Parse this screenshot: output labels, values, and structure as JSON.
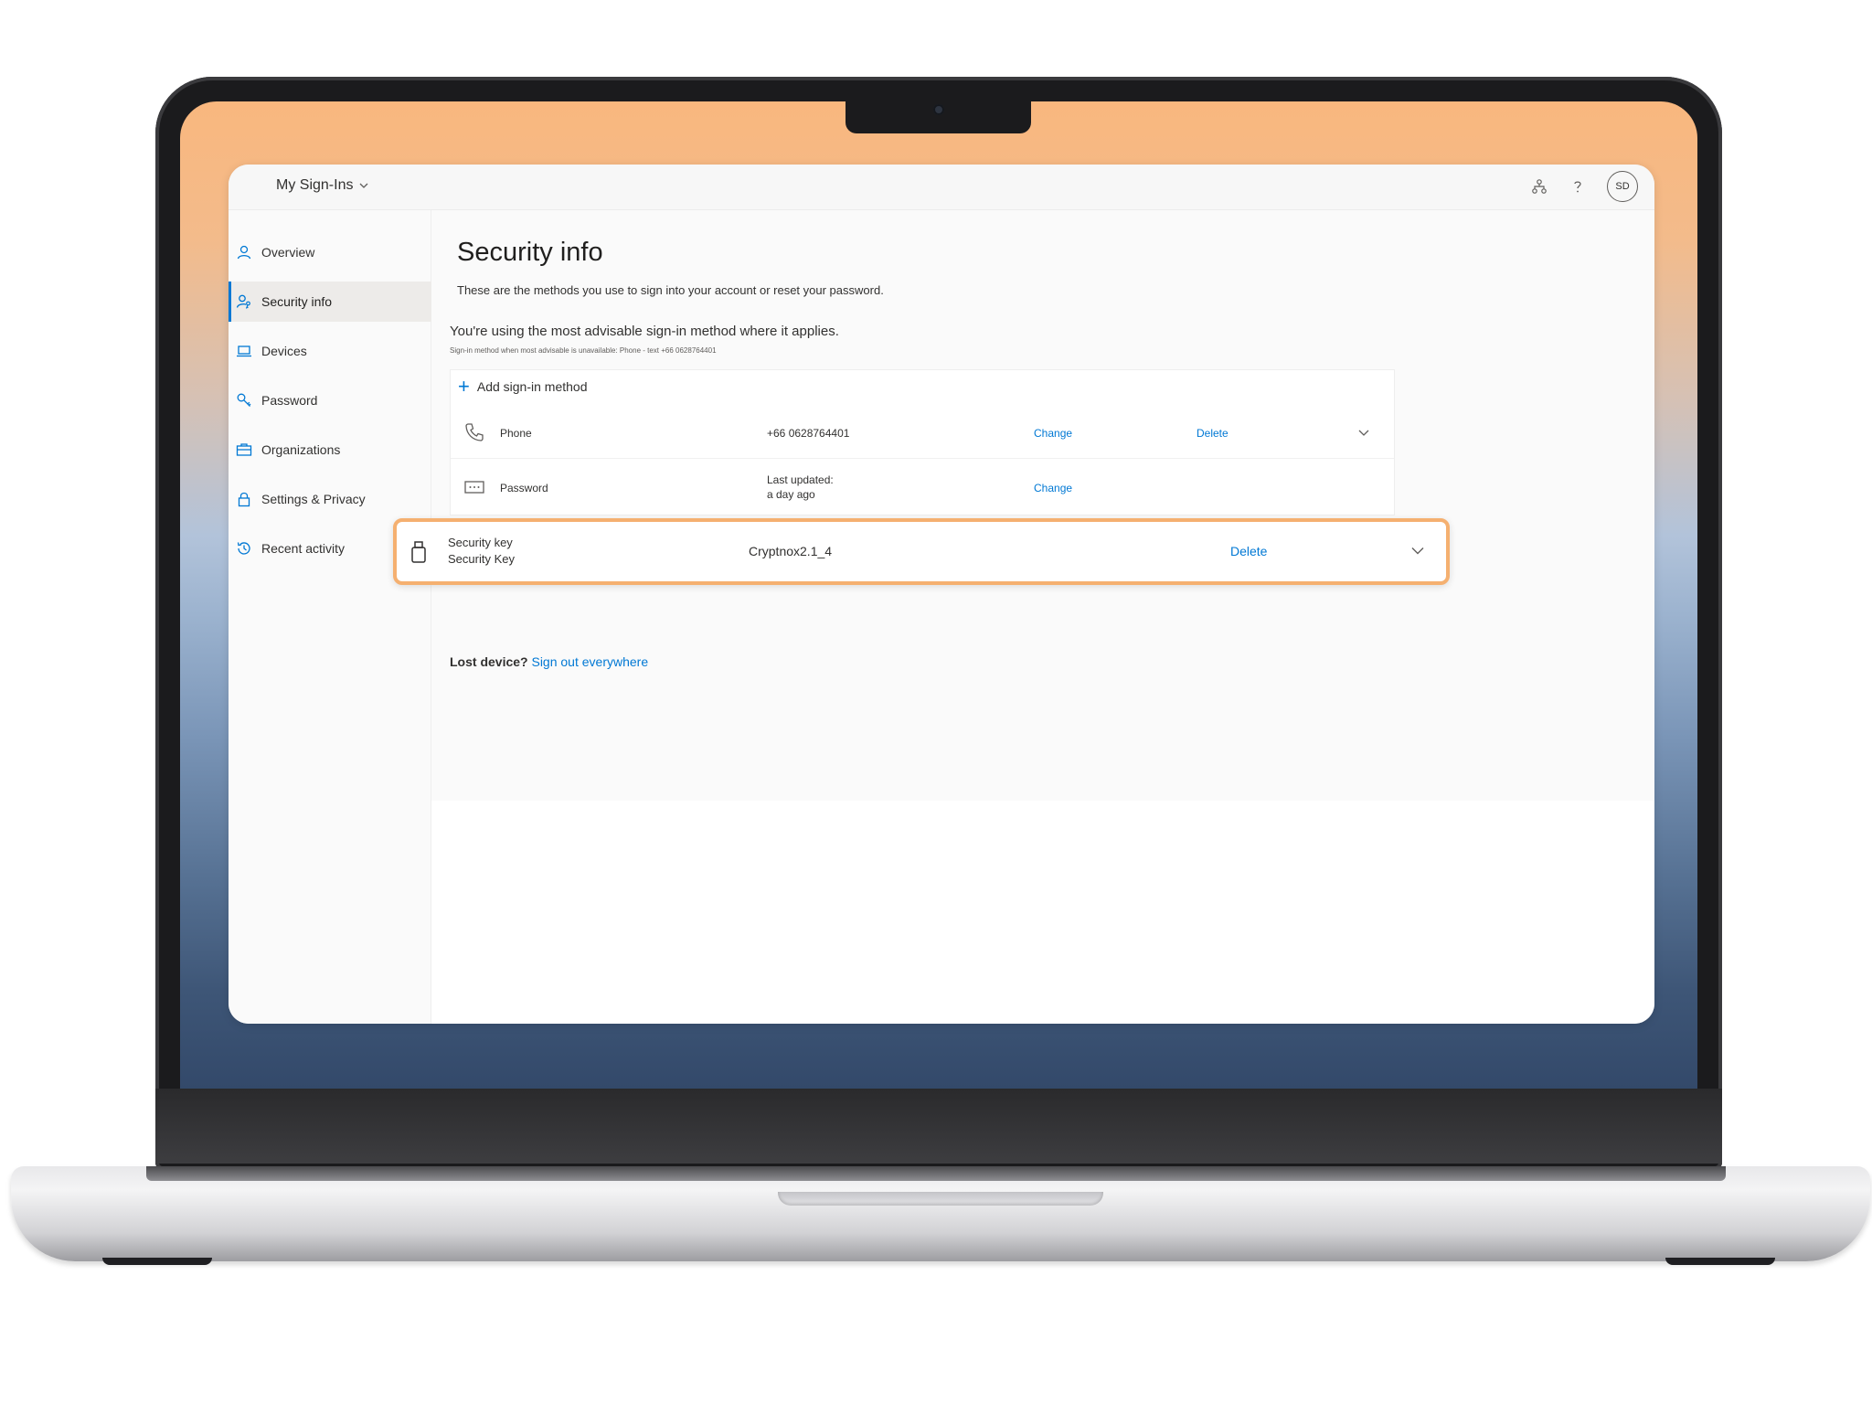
{
  "app": {
    "title": "My Sign-Ins",
    "avatar_initials": "SD",
    "accent_color": "#0078d4",
    "highlight_color": "#f5b070"
  },
  "sidebar": {
    "items": [
      {
        "label": "Overview",
        "icon": "person-icon"
      },
      {
        "label": "Security info",
        "icon": "person-key-icon",
        "active": true
      },
      {
        "label": "Devices",
        "icon": "laptop-icon"
      },
      {
        "label": "Password",
        "icon": "key-icon"
      },
      {
        "label": "Organizations",
        "icon": "briefcase-icon"
      },
      {
        "label": "Settings & Privacy",
        "icon": "lock-icon"
      },
      {
        "label": "Recent activity",
        "icon": "history-icon"
      }
    ]
  },
  "main": {
    "title": "Security info",
    "subtitle": "These are the methods you use to sign into your account or reset your password.",
    "advisable": "You're using the most advisable sign-in method where it applies.",
    "advisable_detail": "Sign-in method when most advisable is unavailable: Phone - text +66 0628764401",
    "add_method": "Add sign-in method",
    "methods": [
      {
        "name": "Phone",
        "value": "+66 0628764401",
        "change": "Change",
        "delete": "Delete",
        "icon": "phone-icon"
      },
      {
        "name": "Password",
        "value_line1": "Last updated:",
        "value_line2": "a day ago",
        "change": "Change",
        "icon": "password-icon"
      }
    ],
    "security_key": {
      "name_line1": "Security key",
      "name_line2": "Security Key",
      "value": "Cryptnox2.1_4",
      "delete": "Delete",
      "icon": "usb-key-icon"
    },
    "lost_device": {
      "question": "Lost device?",
      "link": "Sign out everywhere"
    }
  }
}
